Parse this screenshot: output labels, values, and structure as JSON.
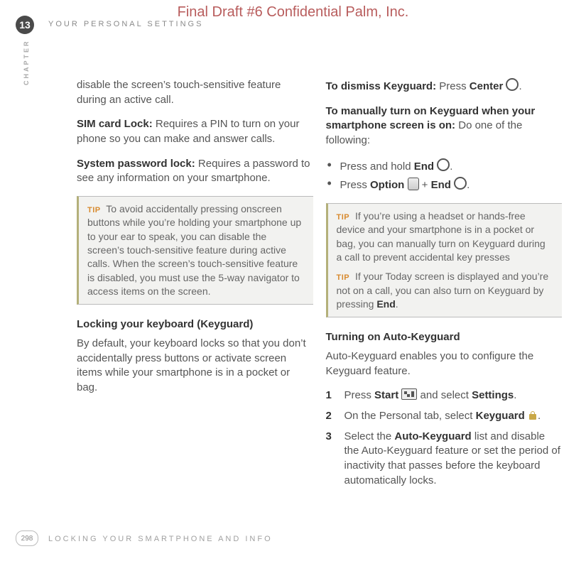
{
  "header": "Final Draft #6     Confidential     Palm, Inc.",
  "chapter_number": "13",
  "chapter_title": "YOUR PERSONAL SETTINGS",
  "chapter_side": "CHAPTER",
  "page_number": "298",
  "footer_title": "LOCKING YOUR SMARTPHONE AND INFO",
  "tip_label": "TIP",
  "left": {
    "p1": "disable the screen’s touch-sensitive feature during an active call.",
    "p2_bold": "SIM card Lock:",
    "p2_rest": " Requires a PIN to turn on your phone so you can make and answer calls.",
    "p3_bold": "System password lock:",
    "p3_rest": " Requires a password to see any information on your smartphone.",
    "tip1": " To avoid accidentally pressing onscreen buttons while you’re holding your smartphone up to your ear to speak, you can disable the screen’s touch-sensitive feature during active calls. When the screen’s touch-sensitive feature is disabled, you must use the 5-way navigator to access items on the screen.",
    "h1": "Locking your keyboard (Keyguard)",
    "p4": "By default, your keyboard locks so that you don’t accidentally press buttons or activate screen items while your smartphone is in a pocket or bag."
  },
  "right": {
    "p1_bold": "To dismiss Keyguard:",
    "p1_rest_a": " Press ",
    "p1_center": "Center",
    "p1_dot": ".",
    "p2_bold": "To manually turn on Keyguard when your smartphone screen is on:",
    "p2_rest": " Do one of the following:",
    "b1_a": "Press and hold ",
    "b1_end": "End",
    "b1_dot": " .",
    "b2_a": "Press ",
    "b2_option": "Option",
    "b2_plus": " + ",
    "b2_end": "End",
    "b2_dot": " .",
    "tip2": " If you’re using a headset or hands-free device and your smartphone is in a pocket or bag, you can manually turn on Keyguard during a call to prevent accidental key presses",
    "tip3": " If your Today screen is displayed and you’re not on a call, you can also turn on Keyguard by pressing ",
    "tip3_end": "End",
    "tip3_dot": ".",
    "h2": "Turning on Auto-Keyguard",
    "p3": "Auto-Keyguard enables you to configure the Keyguard feature.",
    "n1_a": "Press ",
    "n1_start": "Start",
    "n1_b": " and select ",
    "n1_settings": "Settings",
    "n1_dot": ".",
    "n2_a": "On the Personal tab, select ",
    "n2_keyguard": "Keyguard",
    "n2_dot": " .",
    "n3_a": "Select the ",
    "n3_auto": "Auto-Keyguard",
    "n3_b": " list and disable the Auto-Keyguard feature or set the period of inactivity that passes before the keyboard automatically locks."
  }
}
